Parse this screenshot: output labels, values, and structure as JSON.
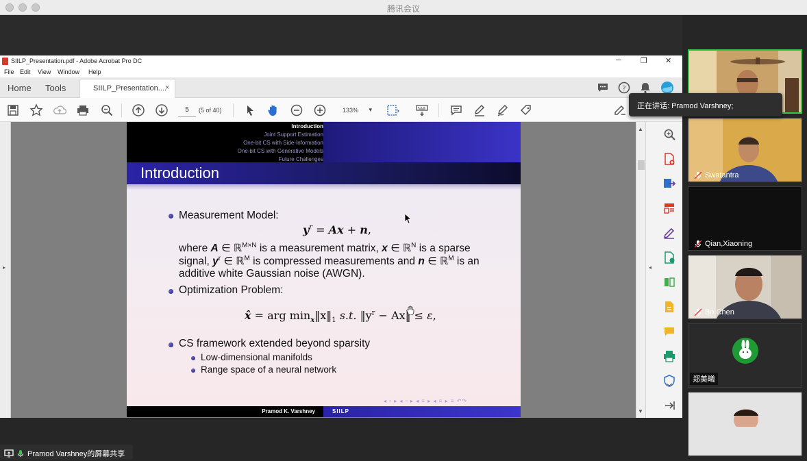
{
  "app": {
    "title": "腾讯会议"
  },
  "acrobat": {
    "title": "SIILP_Presentation.pdf - Adobe Acrobat Pro DC",
    "window_controls": {
      "minimize": "─",
      "restore": "❐",
      "close": "✕"
    },
    "menu": [
      "File",
      "Edit",
      "View",
      "Window",
      "Help"
    ],
    "tabs": {
      "home": "Home",
      "tools": "Tools",
      "document": "SIILP_Presentation....",
      "close": "×"
    },
    "toolbar": {
      "page_current": "5",
      "page_of": "(5 of 40)",
      "zoom": "133%",
      "zoom_caret": "▾"
    },
    "scroll": {
      "up": "▲",
      "down": "▼"
    },
    "panel_left_arrow": "▸",
    "panel_right_arrow": "◂"
  },
  "slide": {
    "nav_items": [
      {
        "label": "Introduction",
        "current": true
      },
      {
        "label": "Joint Support Estimation",
        "current": false
      },
      {
        "label": "One-bit CS with Side-Information",
        "current": false
      },
      {
        "label": "One-bit CS with Generative Models",
        "current": false
      },
      {
        "label": "Future Challenges",
        "current": false
      }
    ],
    "title": "Introduction",
    "bullet1": "Measurement Model:",
    "eq1": {
      "lhs": "y",
      "sup": "r",
      "rest": " = ",
      "ax": "Ax",
      "plus": " + ",
      "n": "n",
      "end": ","
    },
    "where_line1": {
      "a": "where ",
      "A": "A",
      "in": " ∈ ℝ",
      "sup": "M×N",
      "b": " is a measurement matrix, ",
      "x": "x",
      "in2": " ∈ ℝ",
      "sup2": "N",
      "c": " is a sparse"
    },
    "where_line2": {
      "a": "signal, ",
      "y": "y",
      "ysup": "r",
      "in": " ∈ ℝ",
      "sup": "M",
      "b": " is compressed measurements and ",
      "n": "n",
      "in2": " ∈ ℝ",
      "sup2": "M",
      "c": " is an"
    },
    "where_line3": "additive white Gaussian noise (AWGN).",
    "bullet2": "Optimization Problem:",
    "eq2": {
      "xhat": "x̂",
      "eq": " = arg min",
      "sub": "x",
      "norm1": "‖x‖",
      "sub1": "1",
      "st": "  s.t.  ",
      "norm2a": "‖y",
      "sup": "r",
      "norm2b": " − Ax‖ ≤ ",
      "eps": "ε",
      "end": ","
    },
    "bullet3": "CS framework extended beyond sparsity",
    "sub_bullets": [
      "Low-dimensional manifolds",
      "Range space of a neural network"
    ],
    "nav_symbols": "◂ ▫ ▸ ◂ ▫ ▸ ◂ ≡ ▸ ◂ ≡ ▸  ≡  ↶↷",
    "footer_author": "Pramod K. Varshney",
    "footer_short": "SIILP"
  },
  "meeting": {
    "speaking_label": "正在讲话: Pramod Varshney;",
    "share_label": "Pramod Varshney的屏幕共享",
    "participants": [
      {
        "name": "",
        "active": true
      },
      {
        "name": "Swatantra",
        "active": false
      },
      {
        "name": "Qian,Xiaoning",
        "active": false
      },
      {
        "name": "Bo Chen",
        "active": false
      },
      {
        "name": "郑美曦",
        "active": false
      },
      {
        "name": "",
        "active": false
      }
    ]
  },
  "colors": {
    "accent_green": "#35c64b",
    "beamer_blue": "#2a23a6",
    "acrobat_red": "#d93a2b"
  }
}
